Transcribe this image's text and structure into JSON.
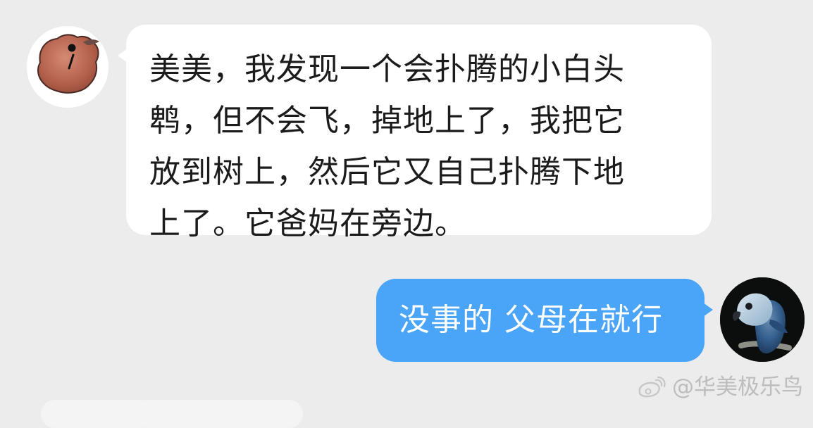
{
  "messages": [
    {
      "side": "left",
      "text": "美美，我发现一个会扑腾的小白头\n鹎，但不会飞，掉地上了，我把它\n放到树上，然后它又自己扑腾下地\n上了。它爸妈在旁边。"
    },
    {
      "side": "right",
      "text": "没事的 父母在就行"
    }
  ],
  "watermark": {
    "text": "@华美极乐鸟"
  },
  "icons": {
    "left_avatar": "bird-avatar-icon",
    "right_avatar": "parrot-avatar-icon",
    "weibo": "weibo-icon"
  },
  "colors": {
    "background": "#ececec",
    "left_bubble": "#ffffff",
    "right_bubble": "#4aa4f8",
    "text_dark": "#1b1b1b",
    "text_light": "#ffffff",
    "watermark": "#bdbdbd"
  }
}
